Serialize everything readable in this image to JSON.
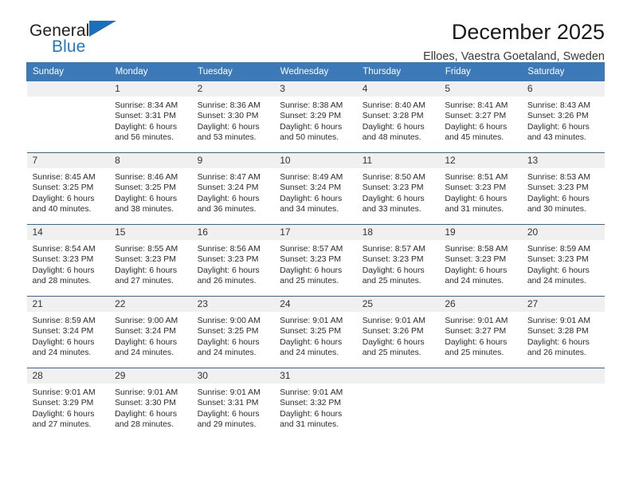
{
  "brand": {
    "name_part1": "General",
    "name_part2": "Blue",
    "logo_icon": "blue-triangle-icon",
    "accent_color": "#1c7bc4"
  },
  "header": {
    "title": "December 2025",
    "subtitle": "Elloes, Vaestra Goetaland, Sweden"
  },
  "theme": {
    "header_bg": "#3b79b8",
    "row_divider": "#2f6aa8",
    "daynum_bg": "#f0f0f0"
  },
  "weekday_headers": [
    "Sunday",
    "Monday",
    "Tuesday",
    "Wednesday",
    "Thursday",
    "Friday",
    "Saturday"
  ],
  "weeks": [
    [
      {
        "day": "",
        "sunrise": "",
        "sunset": "",
        "daylight_line1": "",
        "daylight_line2": ""
      },
      {
        "day": "1",
        "sunrise": "Sunrise: 8:34 AM",
        "sunset": "Sunset: 3:31 PM",
        "daylight_line1": "Daylight: 6 hours",
        "daylight_line2": "and 56 minutes."
      },
      {
        "day": "2",
        "sunrise": "Sunrise: 8:36 AM",
        "sunset": "Sunset: 3:30 PM",
        "daylight_line1": "Daylight: 6 hours",
        "daylight_line2": "and 53 minutes."
      },
      {
        "day": "3",
        "sunrise": "Sunrise: 8:38 AM",
        "sunset": "Sunset: 3:29 PM",
        "daylight_line1": "Daylight: 6 hours",
        "daylight_line2": "and 50 minutes."
      },
      {
        "day": "4",
        "sunrise": "Sunrise: 8:40 AM",
        "sunset": "Sunset: 3:28 PM",
        "daylight_line1": "Daylight: 6 hours",
        "daylight_line2": "and 48 minutes."
      },
      {
        "day": "5",
        "sunrise": "Sunrise: 8:41 AM",
        "sunset": "Sunset: 3:27 PM",
        "daylight_line1": "Daylight: 6 hours",
        "daylight_line2": "and 45 minutes."
      },
      {
        "day": "6",
        "sunrise": "Sunrise: 8:43 AM",
        "sunset": "Sunset: 3:26 PM",
        "daylight_line1": "Daylight: 6 hours",
        "daylight_line2": "and 43 minutes."
      }
    ],
    [
      {
        "day": "7",
        "sunrise": "Sunrise: 8:45 AM",
        "sunset": "Sunset: 3:25 PM",
        "daylight_line1": "Daylight: 6 hours",
        "daylight_line2": "and 40 minutes."
      },
      {
        "day": "8",
        "sunrise": "Sunrise: 8:46 AM",
        "sunset": "Sunset: 3:25 PM",
        "daylight_line1": "Daylight: 6 hours",
        "daylight_line2": "and 38 minutes."
      },
      {
        "day": "9",
        "sunrise": "Sunrise: 8:47 AM",
        "sunset": "Sunset: 3:24 PM",
        "daylight_line1": "Daylight: 6 hours",
        "daylight_line2": "and 36 minutes."
      },
      {
        "day": "10",
        "sunrise": "Sunrise: 8:49 AM",
        "sunset": "Sunset: 3:24 PM",
        "daylight_line1": "Daylight: 6 hours",
        "daylight_line2": "and 34 minutes."
      },
      {
        "day": "11",
        "sunrise": "Sunrise: 8:50 AM",
        "sunset": "Sunset: 3:23 PM",
        "daylight_line1": "Daylight: 6 hours",
        "daylight_line2": "and 33 minutes."
      },
      {
        "day": "12",
        "sunrise": "Sunrise: 8:51 AM",
        "sunset": "Sunset: 3:23 PM",
        "daylight_line1": "Daylight: 6 hours",
        "daylight_line2": "and 31 minutes."
      },
      {
        "day": "13",
        "sunrise": "Sunrise: 8:53 AM",
        "sunset": "Sunset: 3:23 PM",
        "daylight_line1": "Daylight: 6 hours",
        "daylight_line2": "and 30 minutes."
      }
    ],
    [
      {
        "day": "14",
        "sunrise": "Sunrise: 8:54 AM",
        "sunset": "Sunset: 3:23 PM",
        "daylight_line1": "Daylight: 6 hours",
        "daylight_line2": "and 28 minutes."
      },
      {
        "day": "15",
        "sunrise": "Sunrise: 8:55 AM",
        "sunset": "Sunset: 3:23 PM",
        "daylight_line1": "Daylight: 6 hours",
        "daylight_line2": "and 27 minutes."
      },
      {
        "day": "16",
        "sunrise": "Sunrise: 8:56 AM",
        "sunset": "Sunset: 3:23 PM",
        "daylight_line1": "Daylight: 6 hours",
        "daylight_line2": "and 26 minutes."
      },
      {
        "day": "17",
        "sunrise": "Sunrise: 8:57 AM",
        "sunset": "Sunset: 3:23 PM",
        "daylight_line1": "Daylight: 6 hours",
        "daylight_line2": "and 25 minutes."
      },
      {
        "day": "18",
        "sunrise": "Sunrise: 8:57 AM",
        "sunset": "Sunset: 3:23 PM",
        "daylight_line1": "Daylight: 6 hours",
        "daylight_line2": "and 25 minutes."
      },
      {
        "day": "19",
        "sunrise": "Sunrise: 8:58 AM",
        "sunset": "Sunset: 3:23 PM",
        "daylight_line1": "Daylight: 6 hours",
        "daylight_line2": "and 24 minutes."
      },
      {
        "day": "20",
        "sunrise": "Sunrise: 8:59 AM",
        "sunset": "Sunset: 3:23 PM",
        "daylight_line1": "Daylight: 6 hours",
        "daylight_line2": "and 24 minutes."
      }
    ],
    [
      {
        "day": "21",
        "sunrise": "Sunrise: 8:59 AM",
        "sunset": "Sunset: 3:24 PM",
        "daylight_line1": "Daylight: 6 hours",
        "daylight_line2": "and 24 minutes."
      },
      {
        "day": "22",
        "sunrise": "Sunrise: 9:00 AM",
        "sunset": "Sunset: 3:24 PM",
        "daylight_line1": "Daylight: 6 hours",
        "daylight_line2": "and 24 minutes."
      },
      {
        "day": "23",
        "sunrise": "Sunrise: 9:00 AM",
        "sunset": "Sunset: 3:25 PM",
        "daylight_line1": "Daylight: 6 hours",
        "daylight_line2": "and 24 minutes."
      },
      {
        "day": "24",
        "sunrise": "Sunrise: 9:01 AM",
        "sunset": "Sunset: 3:25 PM",
        "daylight_line1": "Daylight: 6 hours",
        "daylight_line2": "and 24 minutes."
      },
      {
        "day": "25",
        "sunrise": "Sunrise: 9:01 AM",
        "sunset": "Sunset: 3:26 PM",
        "daylight_line1": "Daylight: 6 hours",
        "daylight_line2": "and 25 minutes."
      },
      {
        "day": "26",
        "sunrise": "Sunrise: 9:01 AM",
        "sunset": "Sunset: 3:27 PM",
        "daylight_line1": "Daylight: 6 hours",
        "daylight_line2": "and 25 minutes."
      },
      {
        "day": "27",
        "sunrise": "Sunrise: 9:01 AM",
        "sunset": "Sunset: 3:28 PM",
        "daylight_line1": "Daylight: 6 hours",
        "daylight_line2": "and 26 minutes."
      }
    ],
    [
      {
        "day": "28",
        "sunrise": "Sunrise: 9:01 AM",
        "sunset": "Sunset: 3:29 PM",
        "daylight_line1": "Daylight: 6 hours",
        "daylight_line2": "and 27 minutes."
      },
      {
        "day": "29",
        "sunrise": "Sunrise: 9:01 AM",
        "sunset": "Sunset: 3:30 PM",
        "daylight_line1": "Daylight: 6 hours",
        "daylight_line2": "and 28 minutes."
      },
      {
        "day": "30",
        "sunrise": "Sunrise: 9:01 AM",
        "sunset": "Sunset: 3:31 PM",
        "daylight_line1": "Daylight: 6 hours",
        "daylight_line2": "and 29 minutes."
      },
      {
        "day": "31",
        "sunrise": "Sunrise: 9:01 AM",
        "sunset": "Sunset: 3:32 PM",
        "daylight_line1": "Daylight: 6 hours",
        "daylight_line2": "and 31 minutes."
      },
      {
        "day": "",
        "sunrise": "",
        "sunset": "",
        "daylight_line1": "",
        "daylight_line2": ""
      },
      {
        "day": "",
        "sunrise": "",
        "sunset": "",
        "daylight_line1": "",
        "daylight_line2": ""
      },
      {
        "day": "",
        "sunrise": "",
        "sunset": "",
        "daylight_line1": "",
        "daylight_line2": ""
      }
    ]
  ]
}
